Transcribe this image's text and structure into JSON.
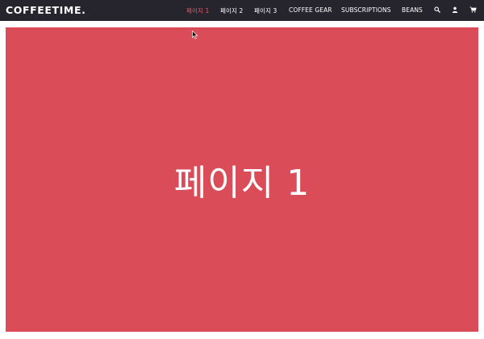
{
  "navbar": {
    "brand": "COFFEETIME.",
    "items": [
      {
        "label": "페이지 1",
        "active": true
      },
      {
        "label": "페이지 2",
        "active": false
      },
      {
        "label": "페이지 3",
        "active": false
      },
      {
        "label": "COFFEE GEAR",
        "active": false
      },
      {
        "label": "SUBSCRIPTIONS",
        "active": false
      },
      {
        "label": "BEANS",
        "active": false
      }
    ],
    "icons": [
      "search-icon",
      "user-icon",
      "cart-icon"
    ]
  },
  "hero": {
    "title": "페이지 1"
  },
  "colors": {
    "navbar_bg": "#26242d",
    "accent": "#e85a63",
    "hero_bg": "#db4c59",
    "text": "#ffffff"
  }
}
